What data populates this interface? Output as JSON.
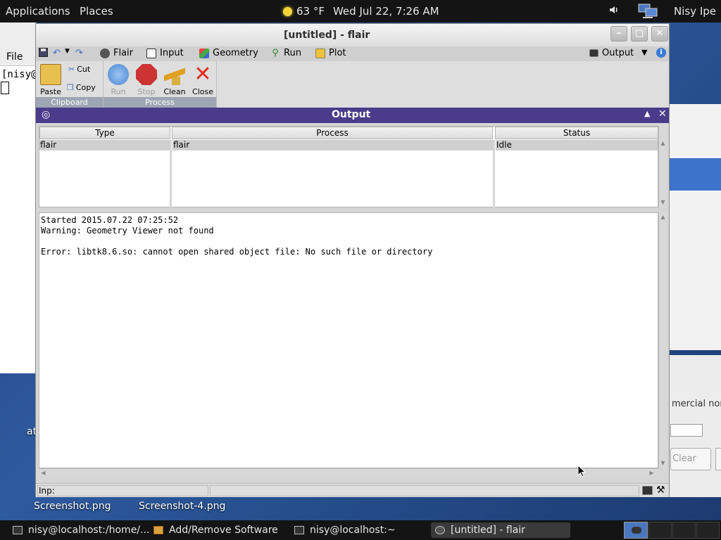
{
  "top_panel": {
    "applications": "Applications",
    "places": "Places",
    "weather": "63 °F",
    "datetime": "Wed Jul 22,  7:26 AM",
    "user": "Nisy Ipe"
  },
  "background": {
    "left_menu": "File",
    "left_terminal": "[nisy@",
    "right_text": "mercial non",
    "right_button": "Clear",
    "desktop_files": [
      "Screenshot.png",
      "Screenshot-4.png"
    ],
    "desktop_fragment": "at"
  },
  "window": {
    "title": "[untitled] - flair",
    "tabs": [
      "Flair",
      "Input",
      "Geometry",
      "Run",
      "Plot"
    ],
    "output_tab": "Output",
    "ribbon": {
      "clipboard": {
        "label": "Clipboard",
        "paste": "Paste",
        "cut": "Cut",
        "copy": "Copy"
      },
      "process": {
        "label": "Process",
        "run": "Run",
        "stop": "Stop",
        "clean": "Clean",
        "close": "Close"
      }
    },
    "output_panel": {
      "title": "Output",
      "columns": [
        "Type",
        "Process",
        "Status"
      ],
      "rows": [
        {
          "type": "flair",
          "process": "flair",
          "status": "Idle"
        }
      ],
      "log": [
        "Started 2015.07.22 07:25:52",
        "Warning: Geometry Viewer not found",
        "",
        "Error: libtk8.6.so: cannot open shared object file: No such file or directory"
      ]
    },
    "status": {
      "input_label": "Inp:"
    }
  },
  "taskbar": {
    "items": [
      "nisy@localhost:/home/...",
      "Add/Remove Software",
      "nisy@localhost:~",
      "[untitled] - flair"
    ]
  },
  "colors": {
    "output_title": "#4a3c8a",
    "panel": "#141414",
    "ribbon_group_label": "#9ea6b3"
  }
}
